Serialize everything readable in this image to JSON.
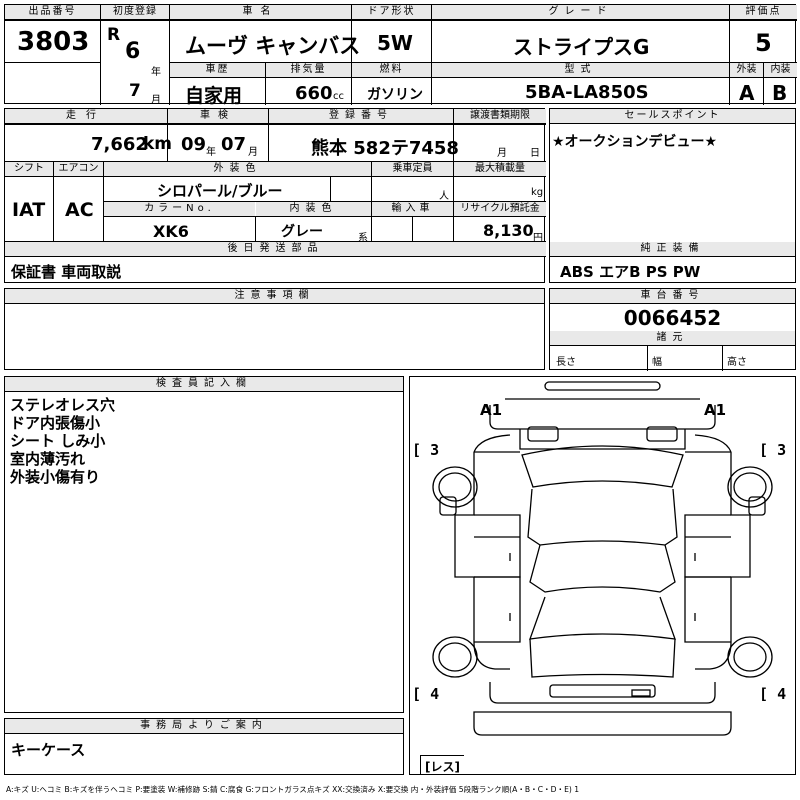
{
  "header": {
    "lot_label": "出品番号",
    "lot_no": "3803",
    "first_reg_label": "初度登録",
    "era": "R",
    "year_num": "6",
    "year_unit": "年",
    "month_num": "7",
    "month_unit": "月",
    "name_label": "車名",
    "name": "ムーヴ キャンバス",
    "door_label": "ドア形状",
    "door": "5W",
    "grade_label": "グレード",
    "grade": "ストライプスG",
    "score_label": "評価点",
    "score": "5",
    "history_label": "車歴",
    "history": "自家用",
    "displacement_label": "排気量",
    "displacement": "660",
    "displacement_unit": "cc",
    "fuel_label": "燃料",
    "fuel": "ガソリン",
    "model_label": "型式",
    "model": "5BA-LA850S",
    "ext_label": "外装",
    "ext": "A",
    "int_label": "内装",
    "int": "B"
  },
  "row2": {
    "mileage_label": "走行",
    "mileage": "7,662",
    "mileage_unit": "km",
    "inspection_label": "車検",
    "insp_year": "09",
    "insp_year_unit": "年",
    "insp_month": "07",
    "insp_month_unit": "月",
    "plate_label": "登録番号",
    "plate": "熊本 582テ7458",
    "transfer_label": "譲渡書類期限",
    "transfer_month_unit": "月",
    "transfer_day_unit": "日",
    "shift_label": "シフト",
    "shift": "IAT",
    "ac_label": "エアコン",
    "ac": "AC",
    "ext_color_label": "外装色",
    "ext_color": "シロパール/ブルー",
    "capacity_label": "乗車定員",
    "capacity_unit": "人",
    "max_load_label": "最大積載量",
    "max_load_unit": "kg",
    "color_no_label": "カラーNo.",
    "color_no": "XK6",
    "int_color_label": "内装色",
    "int_color": "グレー",
    "int_color_unit": "系",
    "import_label": "輸入車",
    "recycle_label": "リサイクル預託金",
    "recycle": "8,130",
    "recycle_unit": "円"
  },
  "sales_point": {
    "label": "セールスポイント",
    "text": "★オークションデビュー★"
  },
  "later_parts": {
    "label": "後日発送部品",
    "text": "保証書 車両取説"
  },
  "genuine": {
    "label": "純正装備",
    "text": "ABS エアB PS PW"
  },
  "notes": {
    "label": "注意事項欄"
  },
  "chassis": {
    "label": "車台番号",
    "number": "0066452",
    "spec_label": "諸元",
    "length_label": "長さ",
    "width_label": "幅",
    "height_label": "高さ"
  },
  "inspector": {
    "label": "検査員記入欄",
    "lines": [
      "ステレオレス穴",
      "ドア内張傷小",
      "シート しみ小",
      "室内薄汚れ",
      "外装小傷有り"
    ]
  },
  "office": {
    "label": "事務局よりご案内",
    "text": "キーケース"
  },
  "diagram": {
    "a1_left": "A1",
    "a1_right": "A1",
    "tag_3_left": "3",
    "tag_3_right": "3",
    "tag_4_left": "4",
    "tag_4_right": "4",
    "tag_les": "レス"
  },
  "legend": "A:キズ U:ヘコミ B:キズを伴うヘコミ P:要塗装 W:補修跡 S:錆 C:腐食 G:フロントガラス点キズ XX:交換済み X:要交換 内・外装評価 5段階ランク順(A・B・C・D・E) 1"
}
